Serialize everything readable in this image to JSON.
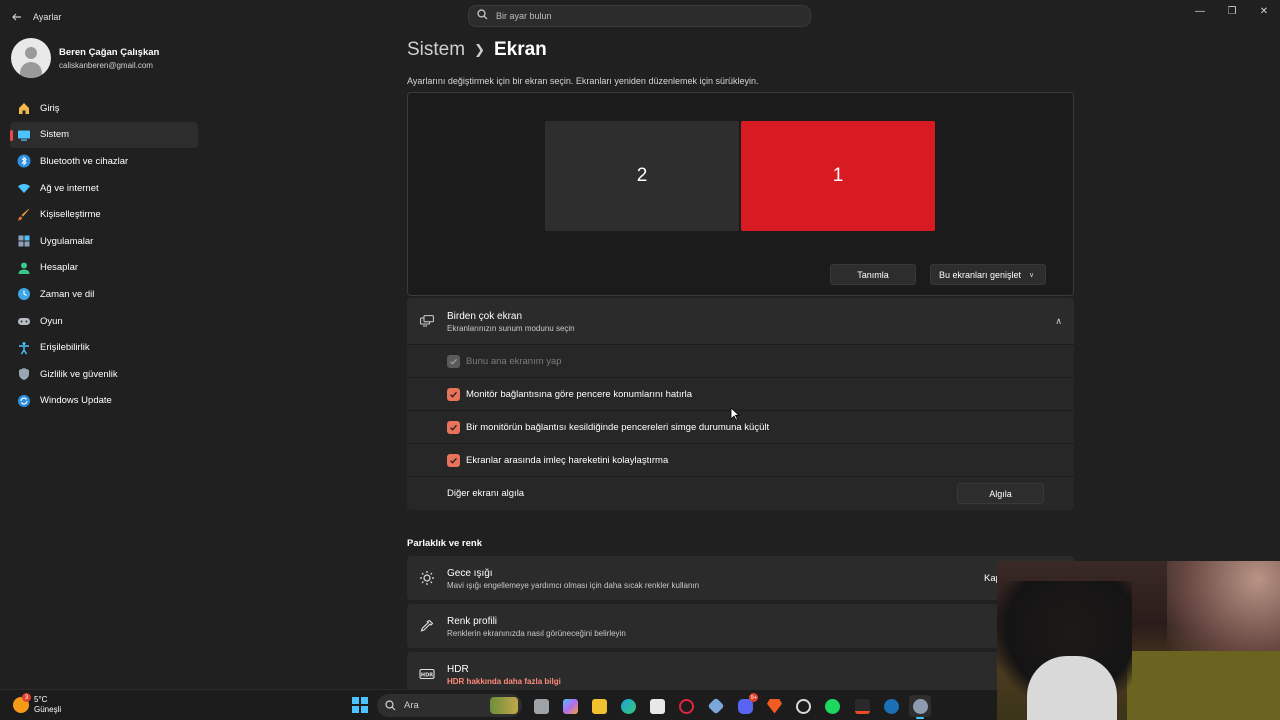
{
  "window": {
    "app_title": "Ayarlar",
    "back_icon": "back-arrow-icon",
    "controls": [
      "minimize-icon",
      "maximize-icon",
      "close-icon"
    ]
  },
  "search": {
    "placeholder": "Bir ayar bulun",
    "icon": "search-icon"
  },
  "profile": {
    "name": "Beren Çağan Çalışkan",
    "email": "caliskanberen@gmail.com"
  },
  "sidebar": {
    "items": [
      {
        "label": "Giriş",
        "icon": "home-icon",
        "active": false
      },
      {
        "label": "Sistem",
        "icon": "system-display-icon",
        "active": true
      },
      {
        "label": "Bluetooth ve cihazlar",
        "icon": "bluetooth-icon",
        "active": false
      },
      {
        "label": "Ağ ve internet",
        "icon": "wifi-icon",
        "active": false
      },
      {
        "label": "Kişiselleştirme",
        "icon": "brush-icon",
        "active": false
      },
      {
        "label": "Uygulamalar",
        "icon": "apps-icon",
        "active": false
      },
      {
        "label": "Hesaplar",
        "icon": "account-icon",
        "active": false
      },
      {
        "label": "Zaman ve dil",
        "icon": "globe-clock-icon",
        "active": false
      },
      {
        "label": "Oyun",
        "icon": "gamepad-icon",
        "active": false
      },
      {
        "label": "Erişilebilirlik",
        "icon": "accessibility-icon",
        "active": false
      },
      {
        "label": "Gizlilik ve güvenlik",
        "icon": "shield-icon",
        "active": false
      },
      {
        "label": "Windows Update",
        "icon": "windows-update-icon",
        "active": false
      }
    ]
  },
  "breadcrumb": {
    "parent": "Sistem",
    "current": "Ekran"
  },
  "description": "Ayarlarını değiştirmek için bir ekran seçin. Ekranları yeniden düzenlemek için sürükleyin.",
  "displays": {
    "monitors": [
      {
        "label": "2",
        "selected": false
      },
      {
        "label": "1",
        "selected": true
      }
    ],
    "identify_label": "Tanımla",
    "extend_label": "Bu ekranları genişlet"
  },
  "multi_display": {
    "title": "Birden çok ekran",
    "subtitle": "Ekranlarınızın sunum modunu seçin",
    "options": [
      {
        "label": "Bunu ana ekranım yap",
        "checked": true,
        "disabled": true
      },
      {
        "label": "Monitör bağlantısına göre pencere konumlarını hatırla",
        "checked": true,
        "disabled": false
      },
      {
        "label": "Bir monitörün bağlantısı kesildiğinde pencereleri simge durumuna küçült",
        "checked": true,
        "disabled": false
      },
      {
        "label": "Ekranlar arasında imleç hareketini kolaylaştırma",
        "checked": true,
        "disabled": false
      }
    ],
    "detect_label": "Diğer ekranı algıla",
    "detect_button": "Algıla"
  },
  "brightness": {
    "section_title": "Parlaklık ve renk",
    "night_light": {
      "title": "Gece ışığı",
      "subtitle": "Mavi ışığı engellemeye yardımcı olması için daha sıcak renkler kullanın",
      "value": "Kap"
    },
    "color_profile": {
      "title": "Renk profili",
      "subtitle": "Renklerin ekranınızda nasıl görüneceğini belirleyin"
    },
    "hdr": {
      "title": "HDR",
      "subtitle": "HDR hakkında daha fazla bilgi"
    }
  },
  "taskbar": {
    "weather": {
      "temp": "5°C",
      "condition": "Güneşli",
      "badge": "3"
    },
    "search_label": "Ara",
    "apps": [
      {
        "name": "task-view-icon",
        "color": "#9ea3a8",
        "badge": ""
      },
      {
        "name": "copilot-icon",
        "color": "#b06cf0",
        "badge": ""
      },
      {
        "name": "file-explorer-icon",
        "color": "#f2c12e",
        "badge": ""
      },
      {
        "name": "edge-icon",
        "color": "#1fa3d9",
        "badge": ""
      },
      {
        "name": "microsoft-store-icon",
        "color": "#e8e8e8",
        "badge": ""
      },
      {
        "name": "opera-gx-icon",
        "color": "#e0263f",
        "badge": ""
      },
      {
        "name": "network-app-icon",
        "color": "#7aa7d8",
        "badge": ""
      },
      {
        "name": "discord-icon",
        "color": "#5865f2",
        "badge": "9+"
      },
      {
        "name": "brave-icon",
        "color": "#f05c22",
        "badge": ""
      },
      {
        "name": "chat-app-icon",
        "color": "#d8d8d8",
        "badge": ""
      },
      {
        "name": "spotify-icon",
        "color": "#1ed760",
        "badge": ""
      },
      {
        "name": "media-app-icon",
        "color": "#ee4a26",
        "badge": ""
      },
      {
        "name": "steam-icon",
        "color": "#1b6fb5",
        "badge": ""
      },
      {
        "name": "settings-icon",
        "color": "#8f9bb0",
        "badge": ""
      }
    ]
  },
  "colors": {
    "accent": "#e9735a",
    "selected_monitor": "#d81b22",
    "active_indicator": "#e94b4b"
  }
}
